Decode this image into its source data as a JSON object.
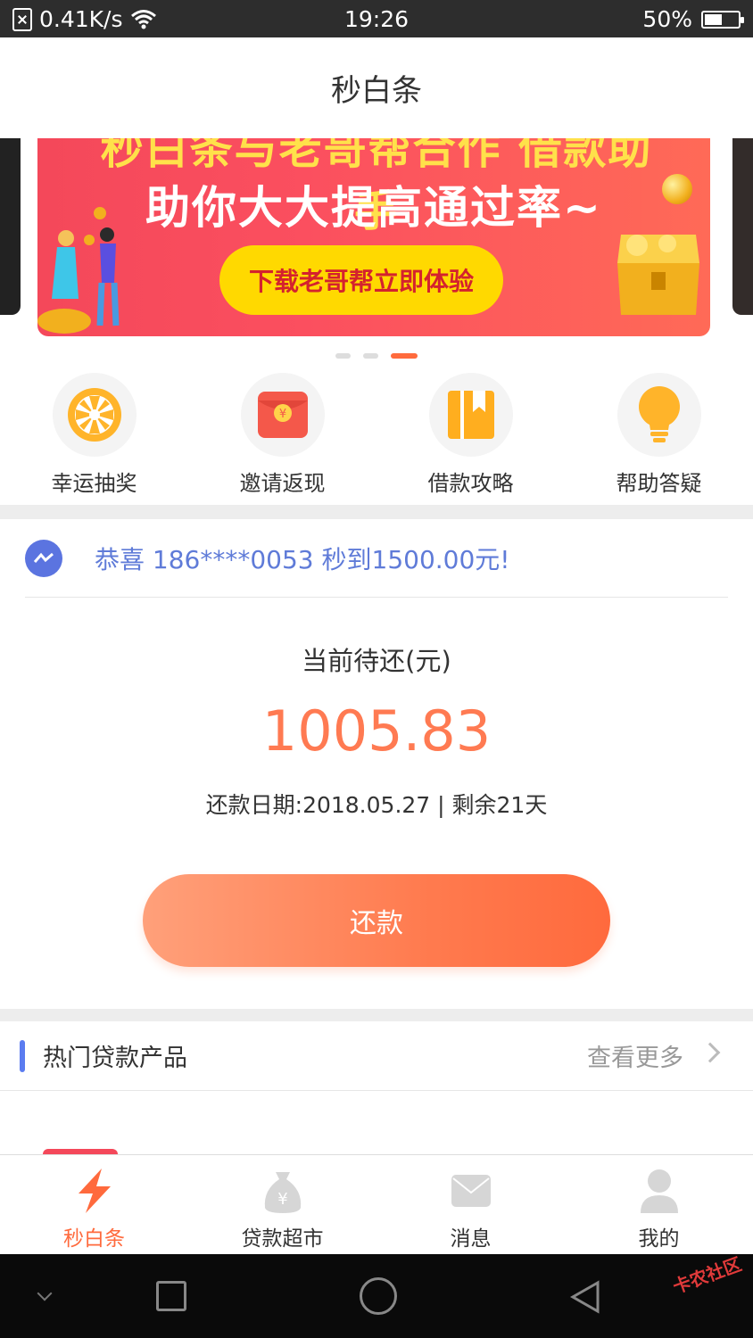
{
  "status_bar": {
    "speed": "0.41K/s",
    "time": "19:26",
    "battery": "50%"
  },
  "header": {
    "title": "秒白条"
  },
  "banner": {
    "top_text": "秒白条与老哥帮合作 借款助手",
    "slogan": "助你大大提高通过率~",
    "cta_label": "下载老哥帮立即体验",
    "slide_count": 3,
    "active_slide": 3
  },
  "menu": [
    {
      "label": "幸运抽奖",
      "icon": "lottery-wheel-icon"
    },
    {
      "label": "邀请返现",
      "icon": "red-envelope-icon"
    },
    {
      "label": "借款攻略",
      "icon": "guide-book-icon"
    },
    {
      "label": "帮助答疑",
      "icon": "lightbulb-icon"
    }
  ],
  "notice": {
    "text": "恭喜 186****0053 秒到1500.00元!",
    "icon": "messenger-icon"
  },
  "repayment": {
    "title": "当前待还(元)",
    "amount": "1005.83",
    "due_info": "还款日期:2018.05.27 | 剩余21天",
    "button_label": "还款"
  },
  "hot_products": {
    "title": "热门贷款产品",
    "more_label": "查看更多"
  },
  "tab_bar": [
    {
      "label": "秒白条",
      "icon": "lightning-icon",
      "active": true
    },
    {
      "label": "贷款超市",
      "icon": "money-bag-icon",
      "active": false
    },
    {
      "label": "消息",
      "icon": "envelope-icon",
      "active": false
    },
    {
      "label": "我的",
      "icon": "user-icon",
      "active": false
    }
  ],
  "watermark": "卡农社区",
  "colors": {
    "accent": "#ff6a3d",
    "notice_blue": "#5f7bd8",
    "section_bar": "#5b7cf0",
    "banner_red": "#f4485a",
    "cta_yellow": "#ffd900"
  }
}
